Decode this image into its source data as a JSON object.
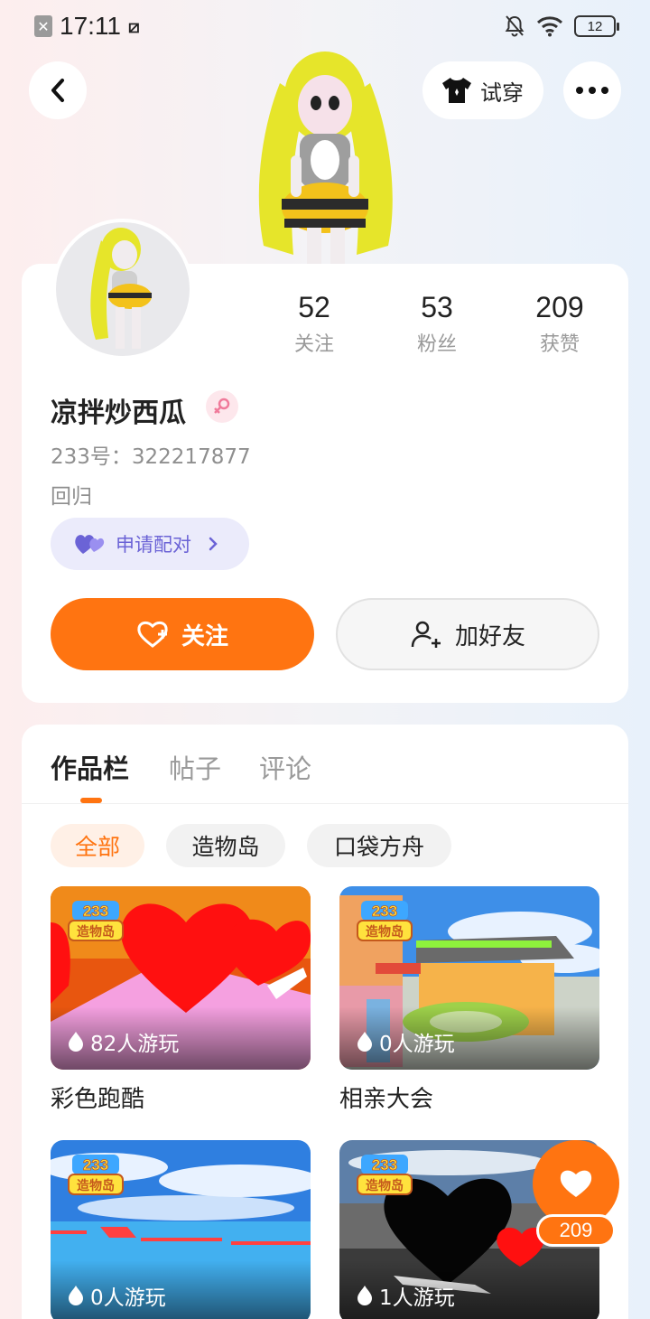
{
  "status_bar": {
    "time": "17:11",
    "battery": "12"
  },
  "header": {
    "try_on_label": "试穿"
  },
  "profile": {
    "stats": [
      {
        "value": "52",
        "label": "关注"
      },
      {
        "value": "53",
        "label": "粉丝"
      },
      {
        "value": "209",
        "label": "获赞"
      }
    ],
    "username": "凉拌炒西瓜",
    "uid": "233号：322217877",
    "bio": "回归",
    "pair_label": "申请配对",
    "follow_label": "关注",
    "add_friend_label": "加好友"
  },
  "tabs": [
    "作品栏",
    "帖子",
    "评论"
  ],
  "filters": [
    "全部",
    "造物岛",
    "口袋方舟"
  ],
  "games": [
    {
      "title": "彩色跑酷",
      "plays": "82人游玩",
      "badge": "233造物岛"
    },
    {
      "title": "相亲大会",
      "plays": "0人游玩",
      "badge": "233造物岛"
    },
    {
      "title": "",
      "plays": "0人游玩",
      "badge": "233造物岛"
    },
    {
      "title": "",
      "plays": "1人游玩",
      "badge": "233造物岛"
    }
  ],
  "like_float": {
    "count": "209"
  },
  "colors": {
    "accent": "#ff7411",
    "pair_purple": "#6b63d6"
  }
}
